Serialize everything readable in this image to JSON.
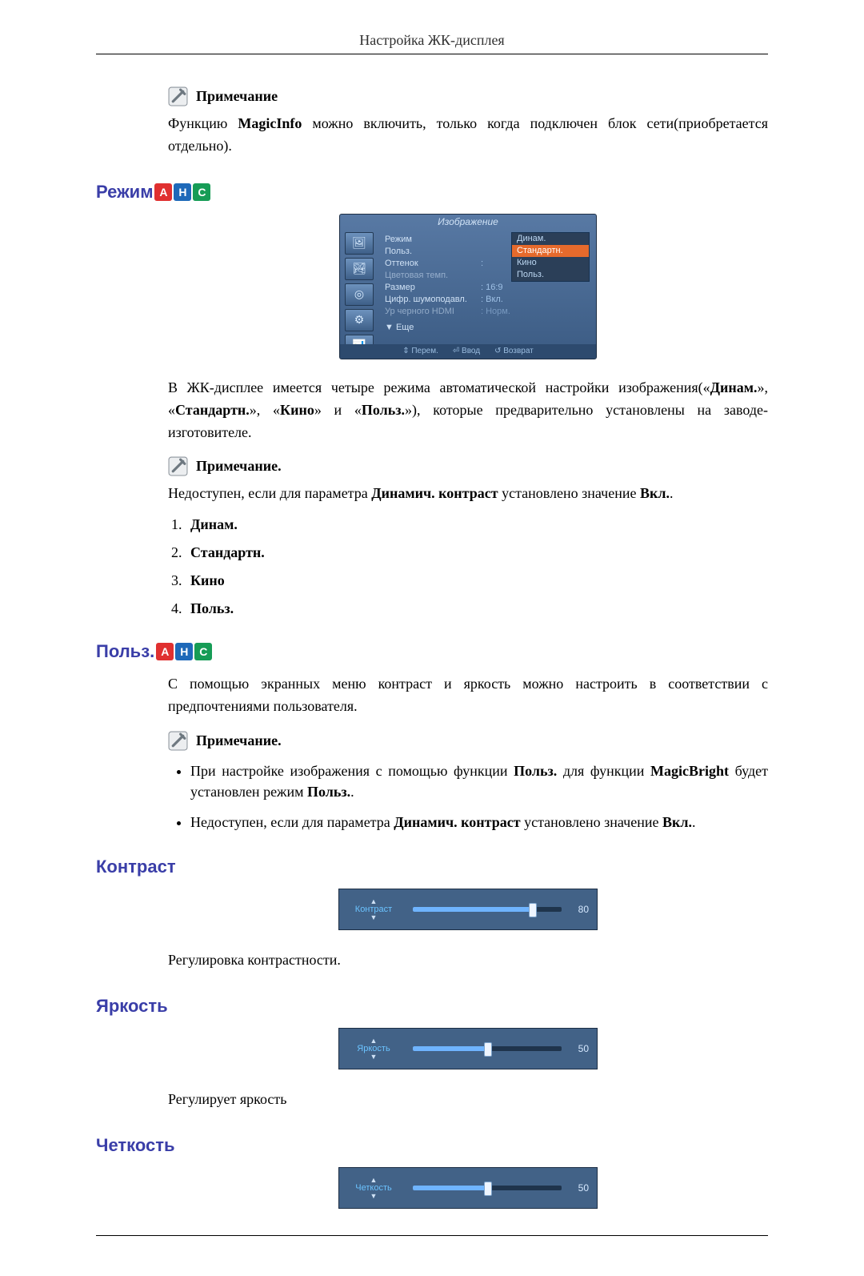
{
  "header": {
    "title": "Настройка ЖК-дисплея"
  },
  "note_label": "Примечание",
  "note_label_dot": "Примечание.",
  "intro_note": {
    "pref": "Функцию ",
    "b1": "MagicInfo",
    "suf": " можно включить, только когда подключен блок сети(приобретается отдельно)."
  },
  "mode_section": {
    "title": "Режим",
    "body_before": "В ЖК-дисплее имеется четыре режима автоматической настройки изображения(«",
    "m1": "Динам.",
    "sep1": "», «",
    "m2": "Стандартн.",
    "sep2": "», «",
    "m3": "Кино",
    "sep3": "» и «",
    "m4": "Польз.",
    "body_after": "»), которые предварительно установлены на заводе-изготовителе.",
    "note_txt_pre": "Недоступен, если для параметра ",
    "note_b1": "Динамич. контраст",
    "note_mid": " установлено значение ",
    "note_b2": "Вкл.",
    "note_end": ".",
    "list": [
      "Динам.",
      "Стандартн.",
      "Кино",
      "Польз."
    ]
  },
  "user_section": {
    "title": "Польз.",
    "body": "С помощью экранных меню контраст и яркость можно настроить в соответствии с предпочтениями пользователя.",
    "bul1_pre": "При настройке изображения с помощью функции ",
    "bul1_b1": "Польз.",
    "bul1_mid": " для функции ",
    "bul1_b2": "MagicBright",
    "bul1_mid2": " будет установлен режим ",
    "bul1_b3": "Польз.",
    "bul1_end": ".",
    "bul2_pre": "Недоступен, если для параметра ",
    "bul2_b1": "Динамич. контраст",
    "bul2_mid": " установлено значение ",
    "bul2_b2": "Вкл.",
    "bul2_end": "."
  },
  "contrast": {
    "title": "Контраст",
    "body": "Регулировка контрастности.",
    "label": "Контраст",
    "value": 80
  },
  "bright": {
    "title": "Яркость",
    "body": "Регулирует яркость",
    "label": "Яркость",
    "value": 50
  },
  "sharp": {
    "title": "Четкость",
    "label": "Четкость",
    "value": 50
  },
  "osd": {
    "title": "Изображение",
    "rows": [
      {
        "lab": "Режим",
        "val": "",
        "dim": false
      },
      {
        "lab": "Польз.",
        "val": "",
        "dim": false
      },
      {
        "lab": "Оттенок",
        "val": ":",
        "dim": false
      },
      {
        "lab": "Цветовая темп.",
        "val": "",
        "dim": true
      },
      {
        "lab": "Размер",
        "val": ": 16:9",
        "dim": false
      },
      {
        "lab": "Цифр. шумоподавл.",
        "val": ": Вкл.",
        "dim": false
      },
      {
        "lab": "Ур черного HDMI",
        "val": ": Норм.",
        "dim": true
      }
    ],
    "more": "▼ Еще",
    "options": [
      "Динам.",
      "Стандартн.",
      "Кино",
      "Польз."
    ],
    "foot": [
      "⇕ Перем.",
      "⏎ Ввод",
      "↺ Возврат"
    ]
  }
}
